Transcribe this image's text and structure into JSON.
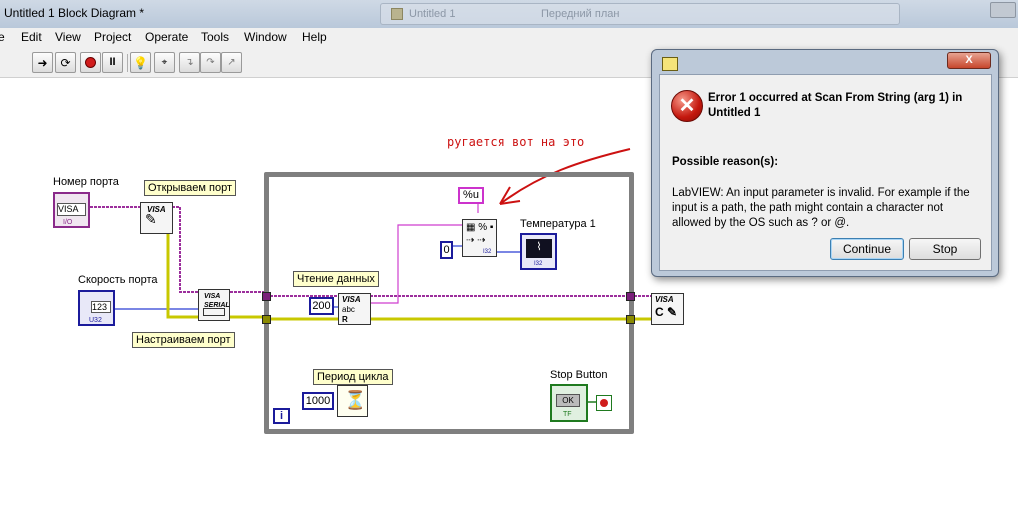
{
  "window": {
    "title": "Untitled 1 Block Diagram *",
    "background_tab_title": "Untitled 1",
    "background_tab_title2": "Передний план"
  },
  "menu": [
    "Edit",
    "View",
    "Project",
    "Operate",
    "Tools",
    "Window",
    "Help"
  ],
  "menu_partial": "e",
  "toolbar": {
    "buttons": [
      "run-arrow-icon",
      "run-continuously-icon",
      "abort-icon",
      "pause-icon",
      "highlight-execution-icon",
      "retain-wire-values-icon",
      "step-into-icon",
      "step-over-icon",
      "step-out-icon"
    ]
  },
  "diagram": {
    "annotation": "ругается вот на это",
    "port_number_label": "Номер порта",
    "port_number_value": "VISA",
    "baud_rate_label": "Скорость порта",
    "baud_rate_value": "123",
    "open_port_label": "Открываем порт",
    "configure_port_label": "Настраиваем порт",
    "read_data_label": "Чтение данных",
    "cycle_period_label": "Период цикла",
    "temperature_label": "Температура 1",
    "stop_button_label": "Stop Button",
    "format_string": "%u",
    "const_zero": "0",
    "const_bytes": "200",
    "const_period": "1000",
    "stop_button_text": "OK",
    "stop_button_tf": "TF",
    "loop_iteration": "i",
    "visa_text": "VISA",
    "visa_serial_text": "VISA SERIAL",
    "visa_read_abc": "abc",
    "visa_read_r": "R",
    "u32_tag": "U32",
    "io_tag": "I/O",
    "i32_tag": "I32",
    "colors": {
      "wire_visa": "#9c2f9c",
      "wire_error": "#c8c800",
      "loop_border": "#7f7f7f",
      "annotation": "#cc1111"
    }
  },
  "dialog": {
    "title_close": "X",
    "error_title": "Error 1 occurred at Scan From String (arg 1) in Untitled 1",
    "reasons_heading": "Possible reason(s):",
    "reason_text": "LabVIEW:  An input parameter is invalid. For example if the input is a path, the path might contain a character not allowed by the OS such as ? or @.",
    "continue_label": "Continue",
    "stop_label": "Stop",
    "error_icon": "error-x-icon"
  }
}
